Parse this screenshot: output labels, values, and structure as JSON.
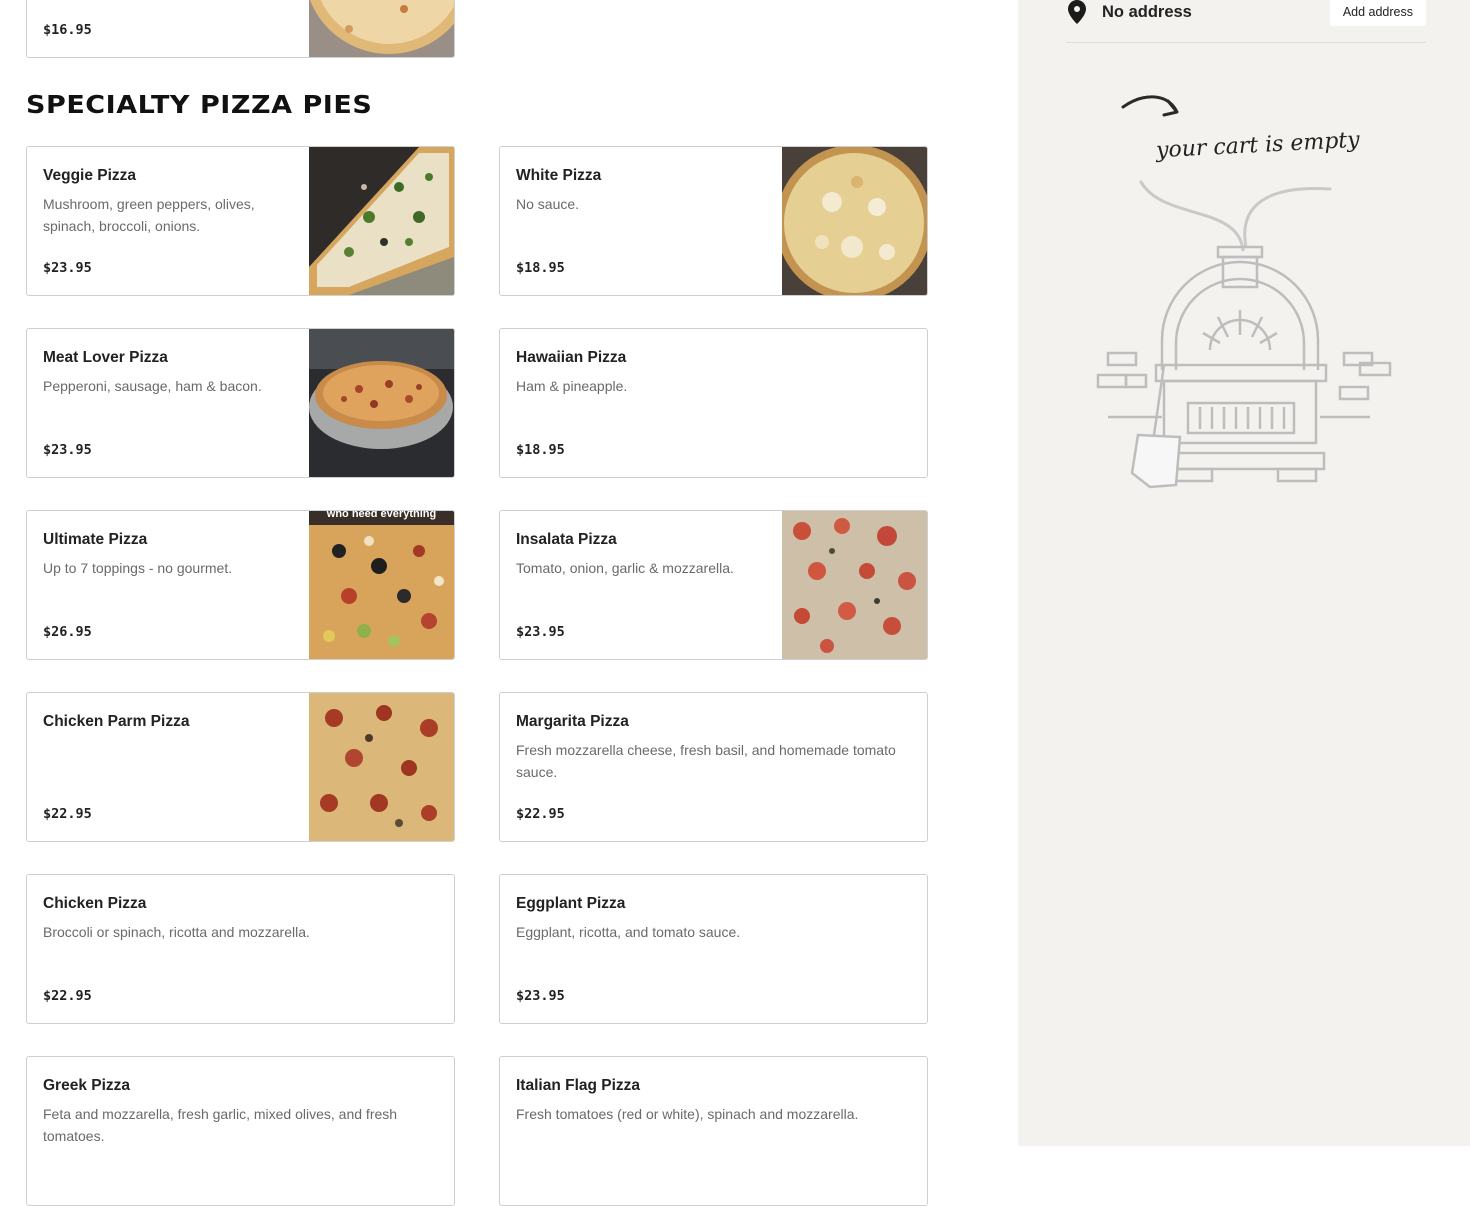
{
  "prev_item": {
    "price": "$16.95"
  },
  "section": {
    "title": "SPECIALTY PIZZA PIES"
  },
  "items": [
    {
      "name": "Veggie Pizza",
      "desc": "Mushroom, green peppers, olives, spinach, broccoli, onions.",
      "price": "$23.95"
    },
    {
      "name": "White Pizza",
      "desc": "No sauce.",
      "price": "$18.95"
    },
    {
      "name": "Meat Lover Pizza",
      "desc": "Pepperoni, sausage, ham & bacon.",
      "price": "$23.95"
    },
    {
      "name": "Hawaiian Pizza",
      "desc": "Ham & pineapple.",
      "price": "$18.95"
    },
    {
      "name": "Ultimate Pizza",
      "desc": "Up to 7 toppings - no gourmet.",
      "price": "$26.95",
      "image_caption": "who need everything"
    },
    {
      "name": "Insalata Pizza",
      "desc": "Tomato, onion, garlic & mozzarella.",
      "price": "$23.95"
    },
    {
      "name": "Chicken Parm Pizza",
      "desc": "",
      "price": "$22.95"
    },
    {
      "name": "Margarita Pizza",
      "desc": "Fresh mozzarella cheese, fresh basil, and homemade tomato sauce.",
      "price": "$22.95"
    },
    {
      "name": "Chicken Pizza",
      "desc": "Broccoli or spinach, ricotta and mozzarella.",
      "price": "$22.95"
    },
    {
      "name": "Eggplant Pizza",
      "desc": "Eggplant, ricotta, and tomato sauce.",
      "price": "$23.95"
    },
    {
      "name": "Greek Pizza",
      "desc": "Feta and mozzarella, fresh garlic, mixed olives, and fresh tomatoes.",
      "price": ""
    },
    {
      "name": "Italian Flag Pizza",
      "desc": "Fresh tomatoes (red or white), spinach and mozzarella.",
      "price": ""
    }
  ],
  "sidebar": {
    "address_text": "No address",
    "add_address_label": "Add address",
    "empty_cart_text": "your cart is empty"
  },
  "icons": {
    "address": "map-pin-icon",
    "cart": "empty-cart-arrow-icon"
  },
  "colors": {
    "sidebar_bg": "#f3f2ef",
    "card_border": "#cfcfcf",
    "text": "#222222",
    "muted": "#6a6a6a"
  }
}
